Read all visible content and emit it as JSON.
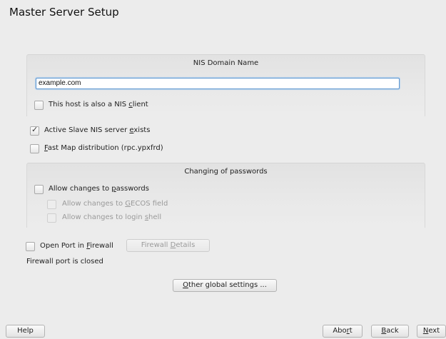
{
  "page_title": "Master Server Setup",
  "nis_domain": {
    "group_title": "NIS Domain Name",
    "value": "example.com",
    "client_checkbox": {
      "pre": "This host is also a NIS ",
      "key": "c",
      "post": "lient",
      "checked": false
    }
  },
  "active_slave": {
    "pre": "Active Slave NIS server ",
    "key": "e",
    "post": "xists",
    "checked": true
  },
  "fast_map": {
    "pre": "",
    "key": "F",
    "post": "ast Map distribution (rpc.ypxfrd)",
    "checked": false
  },
  "passwords": {
    "group_title": "Changing of passwords",
    "allow_changes": {
      "pre": "Allow changes to ",
      "key": "p",
      "post": "asswords",
      "checked": false
    },
    "allow_gecos": {
      "pre": "Allow changes to ",
      "key": "G",
      "post": "ECOS field",
      "checked": false,
      "enabled": false
    },
    "allow_shell": {
      "pre": "Allow changes to login ",
      "key": "s",
      "post": "hell",
      "checked": false,
      "enabled": false
    }
  },
  "firewall": {
    "open_port": {
      "pre": "Open Port in ",
      "key": "F",
      "post": "irewall",
      "checked": false
    },
    "details_button": {
      "pre": "Firewall ",
      "key": "D",
      "post": "etails"
    },
    "status": "Firewall port is closed"
  },
  "other_settings_button": {
    "pre": "",
    "key": "O",
    "post": "ther global settings ..."
  },
  "bottom_bar": {
    "help": "Help",
    "abort": {
      "pre": "Abo",
      "key": "r",
      "post": "t"
    },
    "back": {
      "pre": "",
      "key": "B",
      "post": "ack"
    },
    "next": {
      "pre": "",
      "key": "N",
      "post": "ext"
    }
  }
}
